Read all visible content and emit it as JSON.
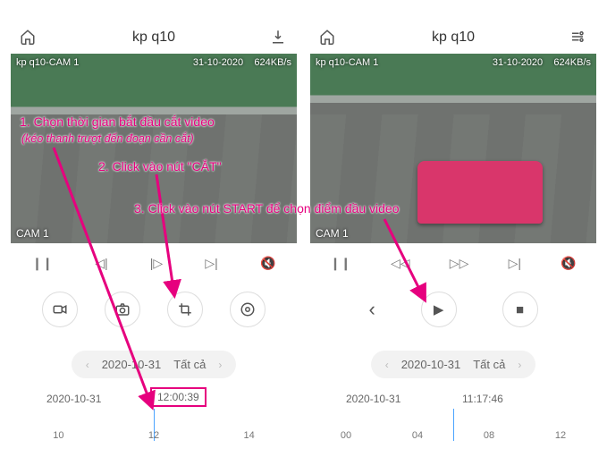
{
  "left": {
    "header": {
      "title": "kp q10"
    },
    "video": {
      "cam_label_top": "kp q10-CAM 1",
      "date": "31-10-2020",
      "bitrate": "624KB/s",
      "cam_label_bottom": "CAM 1"
    },
    "playback": {
      "pause": "❙❙",
      "step_back": "◁|",
      "step_fwd": "|▷",
      "next": "▷|",
      "mute": "🔇"
    },
    "actions": {
      "record": "record-icon",
      "snapshot": "camera-icon",
      "cut": "crop-icon",
      "quality": "hd-icon"
    },
    "date_picker": {
      "date": "2020-10-31",
      "filter": "Tất cả"
    },
    "timeline": {
      "label_left": "2020-10-31",
      "label_right": "12:00:39",
      "ticks": [
        "10",
        "12",
        "14"
      ]
    }
  },
  "right": {
    "header": {
      "title": "kp q10"
    },
    "video": {
      "cam_label_top": "kp q10-CAM 1",
      "date": "31-10-2020",
      "bitrate": "624KB/s",
      "cam_label_bottom": "CAM 1"
    },
    "playback": {
      "pause": "❙❙",
      "rewind": "◁◁",
      "ffwd": "▷▷",
      "next": "▷|",
      "mute": "🔇"
    },
    "actions": {
      "back": "‹",
      "start": "▶",
      "stop": "■"
    },
    "date_picker": {
      "date": "2020-10-31",
      "filter": "Tất cả"
    },
    "timeline": {
      "label_left": "2020-10-31",
      "label_right": "11:17:46",
      "ticks": [
        "00",
        "04",
        "08",
        "12"
      ]
    }
  },
  "annotations": {
    "step1": "1. Chọn thời gian bắt đầu cắt video",
    "step1_sub": "(kéo thanh trượt đến đoạn cần cắt)",
    "step2": "2. Click vào nút \"CẮT\"",
    "step3": "3. Click vào nút START để chọn điểm đầu video"
  },
  "colors": {
    "accent": "#e6007e"
  }
}
